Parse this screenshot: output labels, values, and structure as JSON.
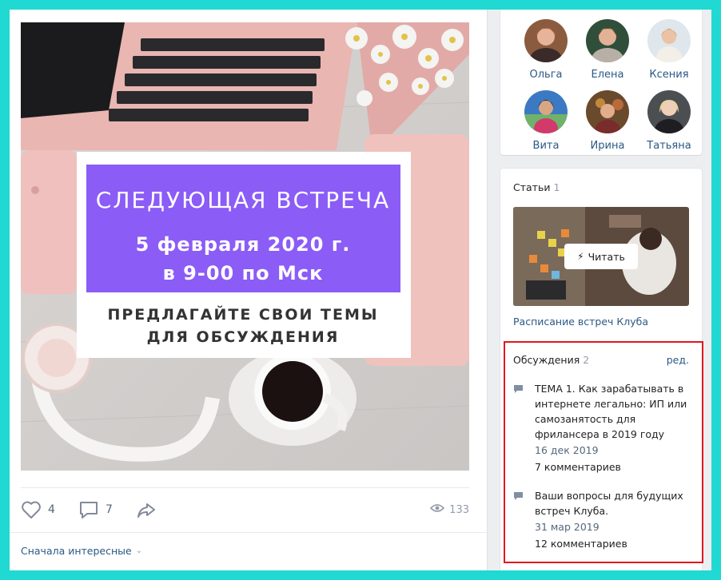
{
  "post": {
    "image_text": {
      "headline": "СЛЕДУЮЩАЯ ВСТРЕЧА",
      "date_line": "5 февраля 2020 г.",
      "time_line": "в 9-00 по Мск",
      "cta_line1": "ПРЕДЛАГАЙТЕ СВОИ ТЕМЫ",
      "cta_line2": "ДЛЯ ОБСУЖДЕНИЯ"
    },
    "likes": "4",
    "comments": "7",
    "views": "133",
    "sort_label": "Сначала интересные"
  },
  "members": [
    {
      "name": "Ольга"
    },
    {
      "name": "Елена"
    },
    {
      "name": "Ксения"
    },
    {
      "name": "Вита"
    },
    {
      "name": "Ирина"
    },
    {
      "name": "Татьяна"
    }
  ],
  "articles": {
    "label": "Статьи",
    "count": "1",
    "read_label": "Читать",
    "item_title": "Расписание встреч Клуба"
  },
  "discussions": {
    "label": "Обсуждения",
    "count": "2",
    "edit_label": "ред.",
    "topics": [
      {
        "title": "ТЕМА 1. Как зарабатывать в интернете легально: ИП или самозанятость для фрилансера в 2019 году",
        "date": "16 дек 2019",
        "comments": "7 комментариев"
      },
      {
        "title": "Ваши вопросы для будущих встреч Клуба.",
        "date": "31 мар 2019",
        "comments": "12 комментариев"
      }
    ]
  },
  "colors": {
    "accent_link": "#2a5885",
    "highlight_border": "#e4141f",
    "banner_purple": "#8b5cf6",
    "outer_background": "#20d9d2"
  }
}
